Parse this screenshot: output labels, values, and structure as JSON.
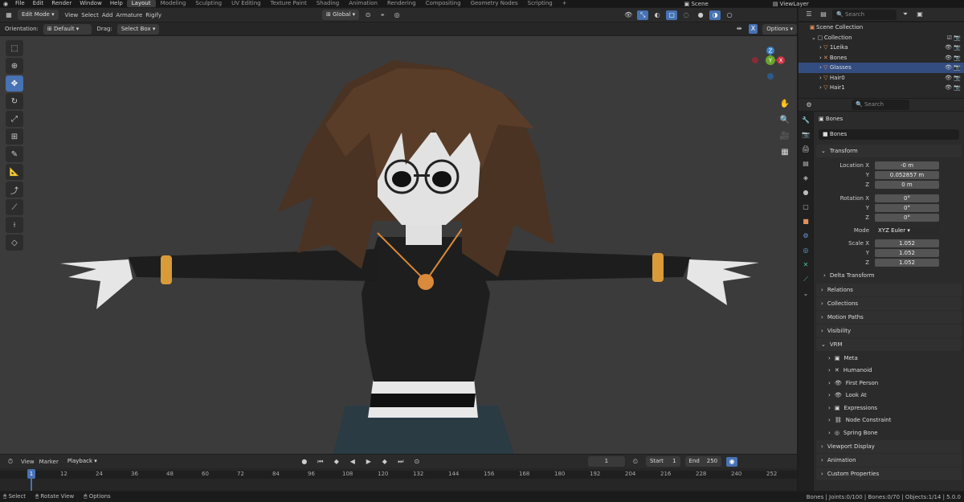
{
  "topbar": {
    "menus": [
      "File",
      "Edit",
      "Render",
      "Window",
      "Help"
    ],
    "workspaces": [
      "Layout",
      "Modeling",
      "Sculpting",
      "UV Editing",
      "Texture Paint",
      "Shading",
      "Animation",
      "Rendering",
      "Compositing",
      "Geometry Nodes",
      "Scripting"
    ],
    "active_workspace": "Layout",
    "add_tab": "+",
    "scene": "Scene",
    "view_layer": "ViewLayer"
  },
  "viewport_header": {
    "mode": "Edit Mode",
    "menus": [
      "View",
      "Select",
      "Add",
      "Armature",
      "Rigify"
    ],
    "transform_orientation": "Global",
    "orientation_label": "Orientation:",
    "orientation_value": "Default",
    "drag_label": "Drag:",
    "drag_value": "Select Box",
    "options": "Options",
    "x_toggle": "X"
  },
  "gizmo": {
    "x": "X",
    "y": "Y",
    "z": "Z"
  },
  "timeline": {
    "menus": [
      "View",
      "Marker"
    ],
    "playback": "Playback",
    "current_frame": "1",
    "start_label": "Start",
    "start": "1",
    "end_label": "End",
    "end": "250",
    "ticks": [
      "1",
      "12",
      "24",
      "36",
      "48",
      "60",
      "72",
      "84",
      "96",
      "108",
      "120",
      "132",
      "144",
      "156",
      "168",
      "180",
      "192",
      "204",
      "216",
      "228",
      "240",
      "252"
    ]
  },
  "statusbar": {
    "select": "Select",
    "rotate": "Rotate View",
    "options": "Options",
    "stats": "Bones | Joints:0/100 | Bones:0/70 | Objects:1/14 | 5.0.0"
  },
  "outliner": {
    "search_placeholder": "Search",
    "root": "Scene Collection",
    "collection": "Collection",
    "items": [
      "1Leika",
      "Bones",
      "Glasses",
      "Hair0",
      "Hair1"
    ],
    "selected": "Glasses"
  },
  "properties": {
    "search_placeholder": "Search",
    "object_name": "Bones",
    "data_name": "Bones",
    "transform_title": "Transform",
    "location_label": "Location X",
    "location": [
      "-0 m",
      "0.052857 m",
      "0 m"
    ],
    "rotation_label": "Rotation X",
    "rotation": [
      "0°",
      "0°",
      "0°"
    ],
    "mode_label": "Mode",
    "mode_value": "XYZ Euler",
    "scale_label": "Scale X",
    "scale": [
      "1.052",
      "1.052",
      "1.052"
    ],
    "axis_y": "Y",
    "axis_z": "Z",
    "delta_transform": "Delta Transform",
    "panels": [
      "Relations",
      "Collections",
      "Motion Paths",
      "Visibility"
    ],
    "vrm_title": "VRM",
    "vrm_items": [
      "Meta",
      "Humanoid",
      "First Person",
      "Look At",
      "Expressions",
      "Node Constraint",
      "Spring Bone"
    ],
    "bottom_panels": [
      "Viewport Display",
      "Animation",
      "Custom Properties"
    ]
  },
  "colors": {
    "accent": "#4772b3",
    "background": "#3b3b3b",
    "selection": "#334d80"
  }
}
